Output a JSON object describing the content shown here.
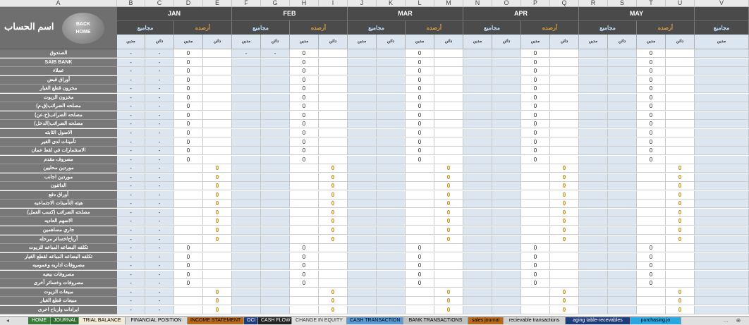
{
  "columns": [
    "A",
    "B",
    "C",
    "D",
    "E",
    "F",
    "G",
    "H",
    "I",
    "J",
    "K",
    "L",
    "M",
    "N",
    "O",
    "P",
    "Q",
    "R",
    "S",
    "T",
    "U",
    "V"
  ],
  "header": {
    "account_title": "اسم الحساب",
    "back_button": "BACK HOME"
  },
  "months": [
    "JAN",
    "FEB",
    "MAR",
    "APR",
    "MAY"
  ],
  "next_month_partial": "",
  "sub_labels": {
    "totals": "مجاميع",
    "balances": "أرصده"
  },
  "dc_labels": {
    "debit": "مدين",
    "credit": "دائن"
  },
  "accounts": [
    "الصندوق",
    "SAIB BANK",
    "عملاء",
    "أوراق قبض",
    "مخزون قطع الغيار",
    "مخزون الزيوت",
    "مصلحه الضرائب(ق.م)",
    "مصلحه الضرائب(خ.عن)",
    "مصلحه الضرائب(الدخل)",
    "الاصول الثابته",
    "تأمينات لدى الغير",
    "الاستثمارات في لقط عمان",
    "مصروف مقدم",
    "موردين محليين",
    "موردين اجانب",
    "الدائنون",
    "أوراق دفع",
    "هيئه التأمينات الاجتماعيه",
    "مصلحه الضرائب (كسب العمل)",
    "الاسهم العاديه",
    "جاري مساهمين",
    "أرباح/خسائر مرحله",
    "تكلفه البضاعه المباعه للزيوت",
    "تكلفه البضاعه المباعه لقطع الغيار",
    "مصروفات اداريه وعموميه",
    "مصروفات بيعيه",
    "مصروفات وخسائر أخرى",
    "مبيعات الزيوت",
    "مبيعات قطع الغيار",
    "ايرادات وارباح اخرى"
  ],
  "values": {
    "dash": "-",
    "zero": "0"
  },
  "tabs": [
    {
      "label": "HOME",
      "bg": "#3a7d3a",
      "fg": "#ffffff"
    },
    {
      "label": "JOURNAL",
      "bg": "#2e6b2e",
      "fg": "#ffffff"
    },
    {
      "label": "TRIAL BALANCE",
      "bg": "#f4ecd6",
      "fg": "#000000"
    },
    {
      "label": "FINANCIAL POSITION",
      "bg": "#d9d9d9",
      "fg": "#000000"
    },
    {
      "label": "INCOME STATEMENT",
      "bg": "#b7691b",
      "fg": "#000000"
    },
    {
      "label": "OCI",
      "bg": "#1f3c7a",
      "fg": "#ffffff"
    },
    {
      "label": "CASH FLOW",
      "bg": "#222222",
      "fg": "#ffffff"
    },
    {
      "label": "CHANGE IN EQUITY",
      "bg": "#e0e0e0",
      "fg": "#333333"
    },
    {
      "label": "CASH TRANSACTION",
      "bg": "#5b9bd5",
      "fg": "#000000"
    },
    {
      "label": "BANK TRANSACTIONS",
      "bg": "#c0c0c0",
      "fg": "#000000"
    },
    {
      "label": "sales journal",
      "bg": "#b7691b",
      "fg": "#000000"
    },
    {
      "label": "recievable transactions",
      "bg": "#d0d0d0",
      "fg": "#000000"
    },
    {
      "label": "aging table-recevables",
      "bg": "#1f3c7a",
      "fg": "#ffffff"
    },
    {
      "label": "purchasing.jo",
      "bg": "#2aa7e0",
      "fg": "#000000"
    }
  ],
  "tab_nav": {
    "prev": "◂",
    "next": "▸",
    "more": "...",
    "add": "⊕"
  }
}
